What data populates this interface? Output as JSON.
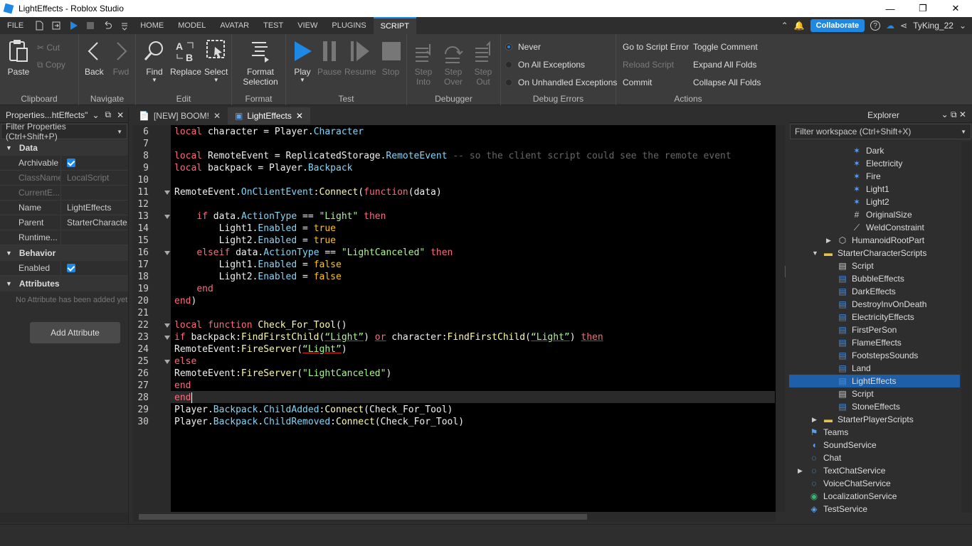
{
  "window": {
    "title": "LightEffects - Roblox Studio"
  },
  "menu": {
    "items": [
      "FILE",
      "HOME",
      "MODEL",
      "AVATAR",
      "TEST",
      "VIEW",
      "PLUGINS",
      "SCRIPT"
    ],
    "active": "SCRIPT",
    "collaborate": "Collaborate",
    "user": "TyKing_22"
  },
  "ribbon": {
    "clipboard": {
      "label": "Clipboard",
      "paste": "Paste",
      "cut": "Cut",
      "copy": "Copy"
    },
    "navigate": {
      "label": "Navigate",
      "back": "Back",
      "fwd": "Fwd"
    },
    "edit": {
      "label": "Edit",
      "find": "Find",
      "replace": "Replace",
      "select": "Select"
    },
    "format": {
      "label": "Format",
      "format_selection": "Format Selection"
    },
    "test": {
      "label": "Test",
      "play": "Play",
      "pause": "Pause",
      "resume": "Resume",
      "stop": "Stop"
    },
    "debugger": {
      "label": "Debugger",
      "step_into": "Step Into",
      "step_over": "Step Over",
      "step_out": "Step Out"
    },
    "debug_errors": {
      "label": "Debug Errors",
      "never": "Never",
      "on_all": "On All Exceptions",
      "on_unhandled": "On Unhandled Exceptions"
    },
    "actions": {
      "label": "Actions",
      "go_to_error": "Go to Script Error",
      "reload": "Reload Script",
      "commit": "Commit",
      "toggle_comment": "Toggle Comment",
      "expand": "Expand All Folds",
      "collapse": "Collapse All Folds"
    }
  },
  "properties": {
    "title": "Properties...htEffects\"",
    "filter": "Filter Properties (Ctrl+Shift+P)",
    "sections": {
      "data": "Data",
      "behavior": "Behavior",
      "attributes": "Attributes"
    },
    "rows": [
      {
        "name": "Archivable",
        "value": ""
      },
      {
        "name": "ClassName",
        "value": "LocalScript"
      },
      {
        "name": "CurrentE...",
        "value": ""
      },
      {
        "name": "Name",
        "value": "LightEffects"
      },
      {
        "name": "Parent",
        "value": "StarterCharacte..."
      },
      {
        "name": "Runtime...",
        "value": ""
      }
    ],
    "enabled": "Enabled",
    "no_attr": "No Attribute has been added yet",
    "add_attr": "Add Attribute"
  },
  "tabs": [
    {
      "label": "[NEW] BOOM!"
    },
    {
      "label": "LightEffects"
    }
  ],
  "code": {
    "line_numbers": [
      "6",
      "7",
      "8",
      "9",
      "10",
      "11",
      "12",
      "13",
      "14",
      "15",
      "16",
      "17",
      "18",
      "19",
      "20",
      "21",
      "22",
      "23",
      "24",
      "25",
      "26",
      "27",
      "28",
      "29",
      "30"
    ]
  },
  "explorer": {
    "title": "Explorer",
    "filter": "Filter workspace (Ctrl+Shift+X)",
    "items": [
      {
        "label": "Dark",
        "indent": 4,
        "icon": "particle"
      },
      {
        "label": "Electricity",
        "indent": 4,
        "icon": "particle"
      },
      {
        "label": "Fire",
        "indent": 4,
        "icon": "particle"
      },
      {
        "label": "Light1",
        "indent": 4,
        "icon": "particle"
      },
      {
        "label": "Light2",
        "indent": 4,
        "icon": "particle"
      },
      {
        "label": "OriginalSize",
        "indent": 4,
        "icon": "value"
      },
      {
        "label": "WeldConstraint",
        "indent": 4,
        "icon": "weld"
      },
      {
        "label": "HumanoidRootPart",
        "indent": 3,
        "icon": "part"
      },
      {
        "label": "StarterCharacterScripts",
        "indent": 2,
        "icon": "folder"
      },
      {
        "label": "Script",
        "indent": 3,
        "icon": "script"
      },
      {
        "label": "BubbleEffects",
        "indent": 3,
        "icon": "localscript"
      },
      {
        "label": "DarkEffects",
        "indent": 3,
        "icon": "localscript"
      },
      {
        "label": "DestroyInvOnDeath",
        "indent": 3,
        "icon": "localscript"
      },
      {
        "label": "ElectricityEffects",
        "indent": 3,
        "icon": "localscript"
      },
      {
        "label": "FirstPerSon",
        "indent": 3,
        "icon": "localscript"
      },
      {
        "label": "FlameEffects",
        "indent": 3,
        "icon": "localscript"
      },
      {
        "label": "FootstepsSounds",
        "indent": 3,
        "icon": "localscript"
      },
      {
        "label": "Land",
        "indent": 3,
        "icon": "localscript"
      },
      {
        "label": "LightEffects",
        "indent": 3,
        "icon": "localscript"
      },
      {
        "label": "Script",
        "indent": 3,
        "icon": "script"
      },
      {
        "label": "StoneEffects",
        "indent": 3,
        "icon": "localscript"
      },
      {
        "label": "StarterPlayerScripts",
        "indent": 2,
        "icon": "folder"
      },
      {
        "label": "Teams",
        "indent": 1,
        "icon": "teams"
      },
      {
        "label": "SoundService",
        "indent": 1,
        "icon": "sound"
      },
      {
        "label": "Chat",
        "indent": 1,
        "icon": "chat"
      },
      {
        "label": "TextChatService",
        "indent": 1,
        "icon": "chat"
      },
      {
        "label": "VoiceChatService",
        "indent": 1,
        "icon": "chat"
      },
      {
        "label": "LocalizationService",
        "indent": 1,
        "icon": "globe"
      },
      {
        "label": "TestService",
        "indent": 1,
        "icon": "test"
      }
    ],
    "selected": "LightEffects"
  },
  "colors": {
    "accent": "#1e88e5",
    "keyword": "#f86d7c",
    "builtin": "#84d6f7",
    "string": "#adf195",
    "method": "#fdfbac",
    "bool": "#ffc600",
    "comment": "#666666"
  }
}
